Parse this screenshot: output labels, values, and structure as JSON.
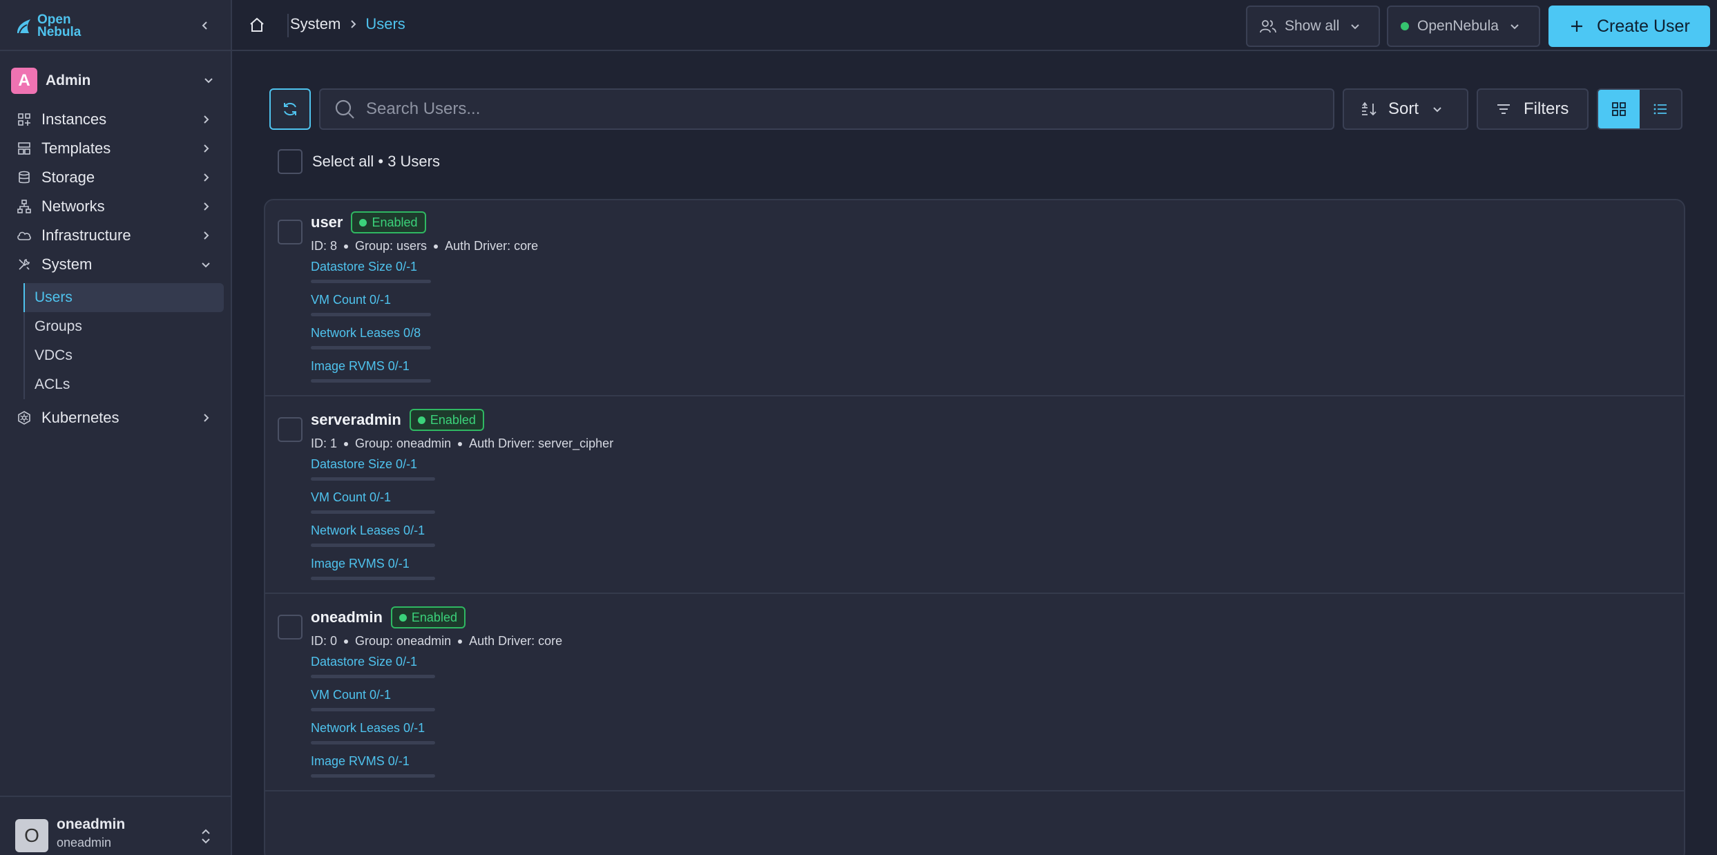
{
  "app": {
    "logo_text_1": "Open",
    "logo_text_2": "Nebula"
  },
  "sidebar": {
    "group_badge": "A",
    "group_label": "Admin",
    "items": [
      {
        "label": "Instances",
        "icon": "instances-icon"
      },
      {
        "label": "Templates",
        "icon": "templates-icon"
      },
      {
        "label": "Storage",
        "icon": "storage-icon"
      },
      {
        "label": "Networks",
        "icon": "networks-icon"
      },
      {
        "label": "Infrastructure",
        "icon": "cloud-icon"
      },
      {
        "label": "System",
        "icon": "tools-icon"
      }
    ],
    "system_sub": [
      {
        "label": "Users"
      },
      {
        "label": "Groups"
      },
      {
        "label": "VDCs"
      },
      {
        "label": "ACLs"
      }
    ],
    "kubernetes_label": "Kubernetes",
    "user": {
      "avatar": "O",
      "name": "oneadmin",
      "group": "oneadmin"
    }
  },
  "header": {
    "breadcrumb": {
      "parent": "System",
      "current": "Users"
    },
    "show_all": "Show all",
    "zone": "OpenNebula",
    "create_label": "Create User"
  },
  "toolbar": {
    "search_placeholder": "Search Users...",
    "sort_label": "Sort",
    "filters_label": "Filters",
    "select_all": "Select all • 3 Users"
  },
  "users": [
    {
      "name": "user",
      "status": "Enabled",
      "id": "ID: 8",
      "group": "Group: users",
      "auth": "Auth Driver: core",
      "quotas": [
        "Datastore Size 0/-1",
        "VM Count 0/-1",
        "Network Leases 0/8",
        "Image RVMS 0/-1"
      ]
    },
    {
      "name": "serveradmin",
      "status": "Enabled",
      "id": "ID: 1",
      "group": "Group: oneadmin",
      "auth": "Auth Driver: server_cipher",
      "quotas": [
        "Datastore Size 0/-1",
        "VM Count 0/-1",
        "Network Leases 0/-1",
        "Image RVMS 0/-1"
      ]
    },
    {
      "name": "oneadmin",
      "status": "Enabled",
      "id": "ID: 0",
      "group": "Group: oneadmin",
      "auth": "Auth Driver: core",
      "quotas": [
        "Datastore Size 0/-1",
        "VM Count 0/-1",
        "Network Leases 0/-1",
        "Image RVMS 0/-1"
      ]
    }
  ],
  "colors": {
    "accent": "#4fc3ee",
    "enabled": "#3bd27a",
    "bg": "#1f2332",
    "panel": "#272b3b"
  }
}
